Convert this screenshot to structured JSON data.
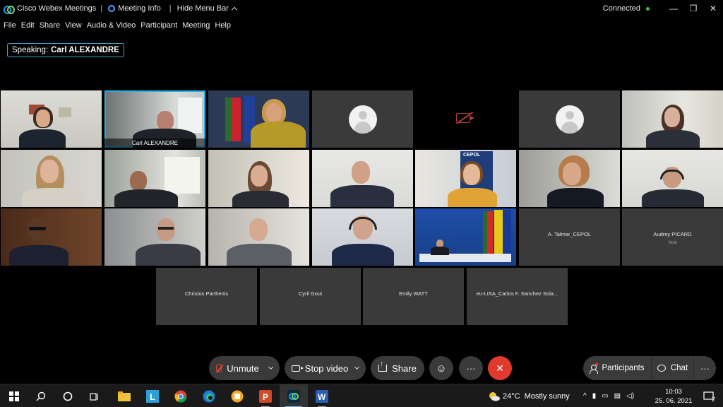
{
  "titlebar": {
    "app_name": "Cisco Webex Meetings",
    "separator": "|",
    "meeting_info": "Meeting Info",
    "hide_menu": "Hide Menu Bar",
    "status": "Connected",
    "status_color": "#3fc240"
  },
  "menu": [
    "File",
    "Edit",
    "Share",
    "View",
    "Audio & Video",
    "Participant",
    "Meeting",
    "Help"
  ],
  "speaking": {
    "label": "Speaking:",
    "name": "Carl ALEXANDRE"
  },
  "tiles": {
    "active_caption": "Carl ALEXANDRE",
    "talmar": "A. Talmar_CEPOL",
    "picard": "Audrey PICARD",
    "picard_role": "Host",
    "parthenis": "Christos Parthenis",
    "gout": "Cyril Gout",
    "watt": "Emily WATT",
    "lisa": "eu-LISA_Carlos F. Sanchez Sola..."
  },
  "controls": {
    "unmute": "Unmute",
    "stop_video": "Stop video",
    "share": "Share",
    "more": "···",
    "end": "✕",
    "participants": "Participants",
    "chat": "Chat"
  },
  "taskbar": {
    "weather_temp": "24°C",
    "weather_text": "Mostly sunny",
    "time": "10:03",
    "date": "25. 06. 2021",
    "notifications": "2"
  },
  "colors": {
    "accent": "#26b0e8",
    "end_call": "#e03a2e",
    "control_bg": "#3a3a3a"
  }
}
